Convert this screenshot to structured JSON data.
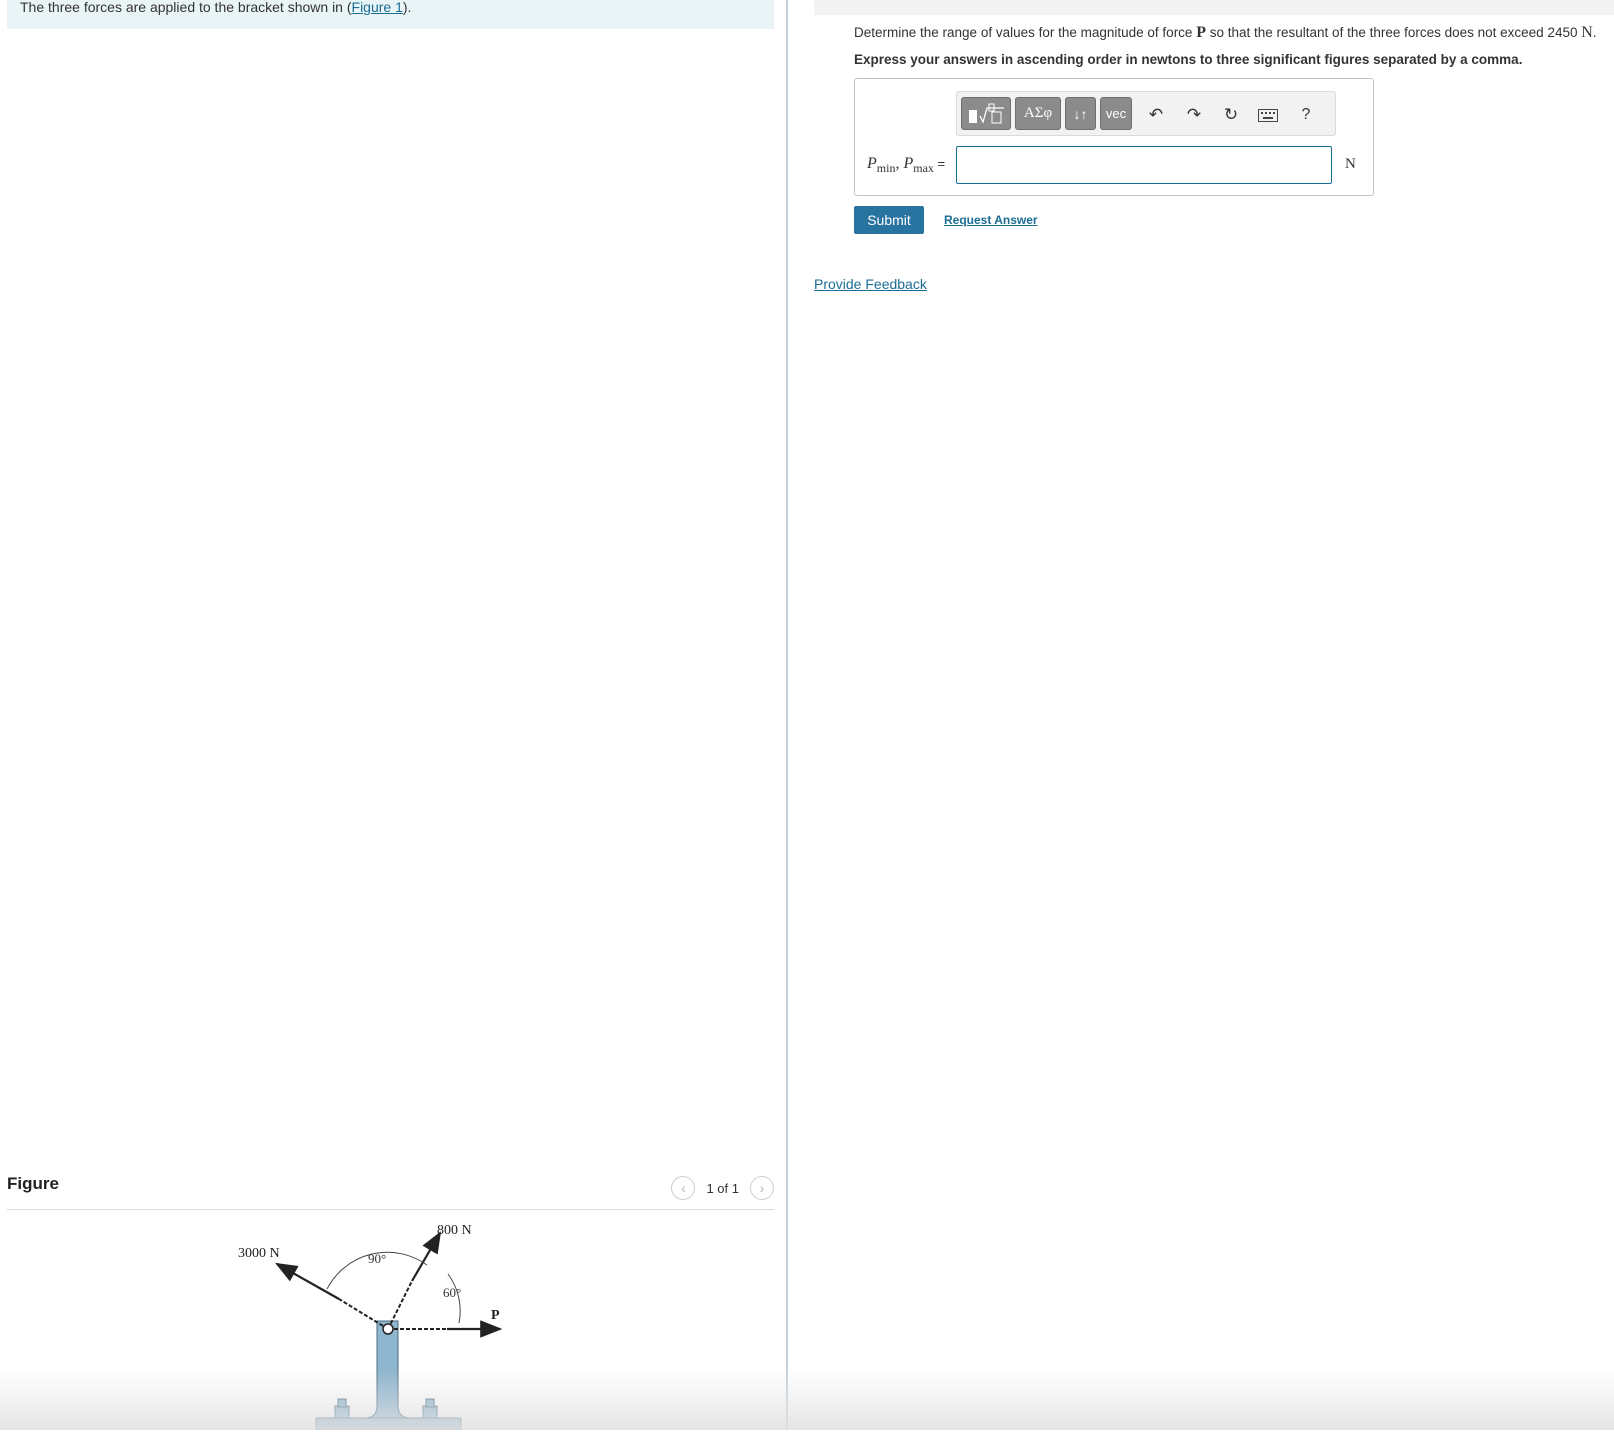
{
  "intro": {
    "text_before": "The three forces are applied to the bracket shown in (",
    "link": "Figure 1",
    "text_after": ")."
  },
  "figure": {
    "title": "Figure",
    "pager": {
      "prev_icon": "chevron-left-icon",
      "text": "1 of 1",
      "next_icon": "chevron-right-icon"
    },
    "labels": {
      "force_3000": "3000 N",
      "force_800": "800 N",
      "angle_90": "90°",
      "angle_60": "60°",
      "force_p": "P"
    }
  },
  "question": {
    "prefix": "Determine the range of values for the magnitude of force ",
    "var": "P",
    "middle": " so that the resultant of the three forces does not exceed 2450 ",
    "unit": "N",
    "suffix": ".",
    "instruction": "Express your answers in ascending order in newtons to three significant figures separated by a comma."
  },
  "answer": {
    "toolbar": {
      "templates_icon": "templates-icon",
      "greek_label": "ΑΣφ",
      "arrows_label": "↓↑",
      "vec_label": "vec",
      "undo_icon": "undo-icon",
      "redo_icon": "redo-icon",
      "reset_icon": "reset-icon",
      "keyboard_icon": "keyboard-icon",
      "help_label": "?"
    },
    "label_p1": "P",
    "label_sub1": "min",
    "label_sep": ", ",
    "label_p2": "P",
    "label_sub2": "max",
    "label_eq": " =",
    "input_value": "",
    "unit": "N"
  },
  "actions": {
    "submit_label": "Submit",
    "request_label": "Request Answer",
    "feedback_label": "Provide Feedback"
  },
  "colors": {
    "accent": "#2874a0",
    "link": "#1b6d94",
    "bracket": "#8fb6cf",
    "intro_bg": "#e9f4f6"
  }
}
